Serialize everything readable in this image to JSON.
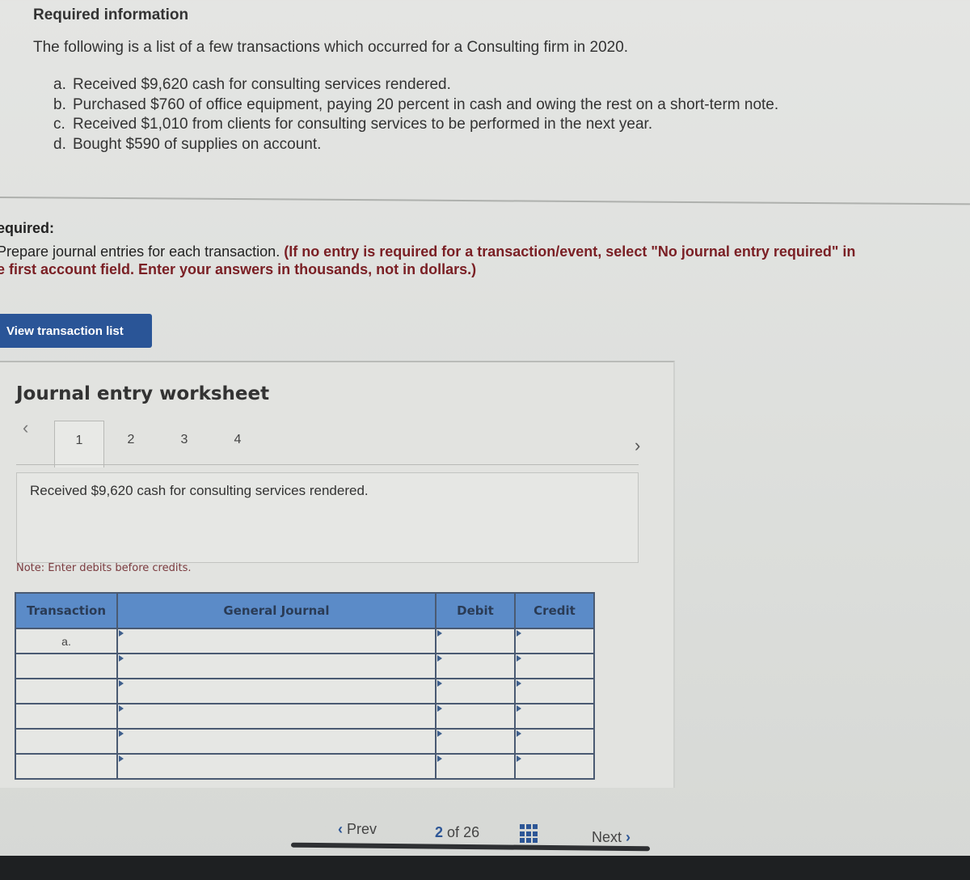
{
  "header": {
    "title": "Required information",
    "intro": "The following is a list of a few transactions which occurred for a Consulting firm in 2020."
  },
  "transactions": [
    {
      "label": "a.",
      "text": "Received $9,620 cash for consulting services rendered."
    },
    {
      "label": "b.",
      "text": "Purchased $760 of office equipment, paying 20 percent in cash and owing the rest on a short-term note."
    },
    {
      "label": "c.",
      "text": "Received $1,010 from clients for consulting services to be performed in the next year."
    },
    {
      "label": "d.",
      "text": "Bought $590 of supplies on account."
    }
  ],
  "required": {
    "heading": "equired:",
    "instruction_plain": "Prepare journal entries for each transaction. ",
    "instruction_bold_1": "(If no entry is required for a transaction/event, select \"No journal entry required\" in",
    "instruction_bold_2": "e first account field. Enter your answers in thousands, not in dollars.)"
  },
  "view_button": "View transaction list",
  "worksheet": {
    "title": "Journal entry worksheet",
    "tabs": [
      "1",
      "2",
      "3",
      "4"
    ],
    "active_tab": "1",
    "description": "Received $9,620 cash for consulting services rendered.",
    "note": "Note: Enter debits before credits.",
    "table": {
      "headers": [
        "Transaction",
        "General Journal",
        "Debit",
        "Credit"
      ],
      "rows": [
        {
          "transaction": "a.",
          "account": "",
          "debit": "",
          "credit": ""
        },
        {
          "transaction": "",
          "account": "",
          "debit": "",
          "credit": ""
        },
        {
          "transaction": "",
          "account": "",
          "debit": "",
          "credit": ""
        },
        {
          "transaction": "",
          "account": "",
          "debit": "",
          "credit": ""
        },
        {
          "transaction": "",
          "account": "",
          "debit": "",
          "credit": ""
        },
        {
          "transaction": "",
          "account": "",
          "debit": "",
          "credit": ""
        }
      ]
    }
  },
  "footer": {
    "prev": "Prev",
    "current": "2",
    "of": "of",
    "total": "26",
    "next": "Next"
  },
  "colors": {
    "accent": "#2a5597",
    "table_header": "#5b8bc8",
    "instruction_bold": "#7a1f24"
  }
}
